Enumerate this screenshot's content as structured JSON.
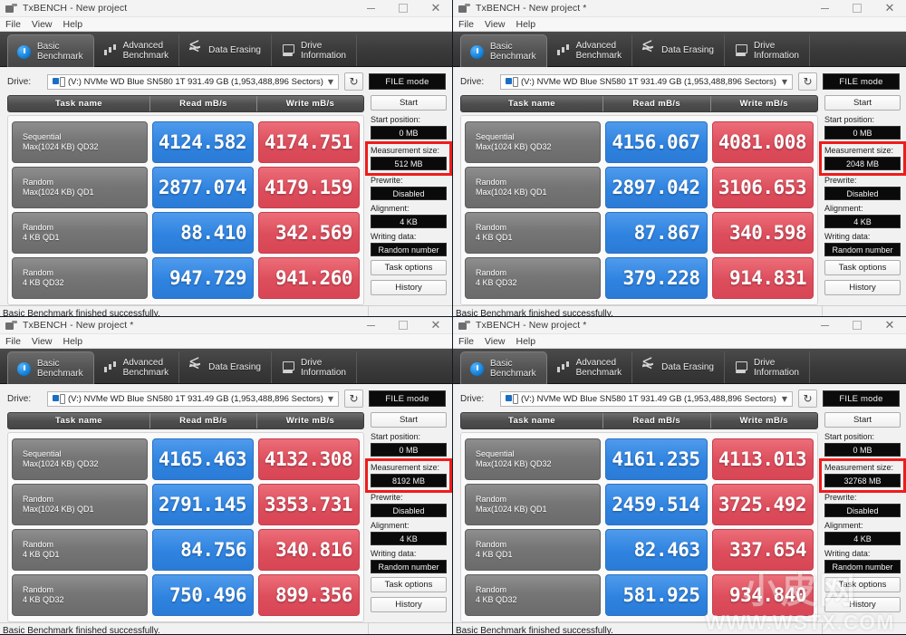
{
  "window": {
    "icon": "app-icon",
    "controls": {
      "minimize": "minimize-icon",
      "maximize": "maximize-icon",
      "close": "close-icon"
    },
    "menu": [
      "File",
      "View",
      "Help"
    ]
  },
  "tabs": [
    {
      "label": "Basic\nBenchmark",
      "icon": "stopwatch-icon",
      "active": true
    },
    {
      "label": "Advanced\nBenchmark",
      "icon": "bar-chart-icon",
      "active": false
    },
    {
      "label": "Data Erasing",
      "icon": "waves-icon",
      "active": false
    },
    {
      "label": "Drive\nInformation",
      "icon": "drive-icon",
      "active": false
    }
  ],
  "drive": {
    "label": "Drive:",
    "value": "(V:) NVMe WD Blue SN580 1T  931.49 GB (1,953,488,896 Sectors)",
    "refresh_icon": "refresh-icon",
    "caret_icon": "chevron-down-icon",
    "mode_button": "FILE mode"
  },
  "table": {
    "headers": [
      "Task name",
      "Read mB/s",
      "Write mB/s"
    ],
    "tasks": [
      "Sequential\nMax(1024 KB) QD32",
      "Random\nMax(1024 KB) QD1",
      "Random\n4 KB QD1",
      "Random\n4 KB QD32"
    ]
  },
  "sidebar_labels": {
    "start": "Start",
    "start_position": "Start position:",
    "measurement_size": "Measurement size:",
    "prewrite": "Prewrite:",
    "alignment": "Alignment:",
    "writing_data": "Writing data:",
    "task_options": "Task options",
    "history": "History"
  },
  "sidebar_values": {
    "start_position": "0 MB",
    "prewrite": "Disabled",
    "alignment": "4 KB",
    "writing_data": "Random number"
  },
  "status": "Basic Benchmark finished successfully.",
  "colors": {
    "read_bar": "#2f83e0",
    "write_bar": "#dd4d5c",
    "highlight_box": "#ee1c1c",
    "tabstrip": "#3a3a3a",
    "value_text": "#ffffff"
  },
  "watermark": {
    "glyphs": "小皮网",
    "url": "WWW.WSTX.COM"
  },
  "panels": [
    {
      "title": "TxBENCH - New project",
      "measurement_size": "512 MB",
      "read": [
        "4124.582",
        "2877.074",
        "88.410",
        "947.729"
      ],
      "write": [
        "4174.751",
        "4179.159",
        "342.569",
        "941.260"
      ]
    },
    {
      "title": "TxBENCH - New project *",
      "measurement_size": "2048 MB",
      "read": [
        "4156.067",
        "2897.042",
        "87.867",
        "379.228"
      ],
      "write": [
        "4081.008",
        "3106.653",
        "340.598",
        "914.831"
      ]
    },
    {
      "title": "TxBENCH - New project *",
      "measurement_size": "8192 MB",
      "read": [
        "4165.463",
        "2791.145",
        "84.756",
        "750.496"
      ],
      "write": [
        "4132.308",
        "3353.731",
        "340.816",
        "899.356"
      ]
    },
    {
      "title": "TxBENCH - New project *",
      "measurement_size": "32768 MB",
      "read": [
        "4161.235",
        "2459.514",
        "82.463",
        "581.925"
      ],
      "write": [
        "4113.013",
        "3725.492",
        "337.654",
        "934.840"
      ]
    }
  ]
}
